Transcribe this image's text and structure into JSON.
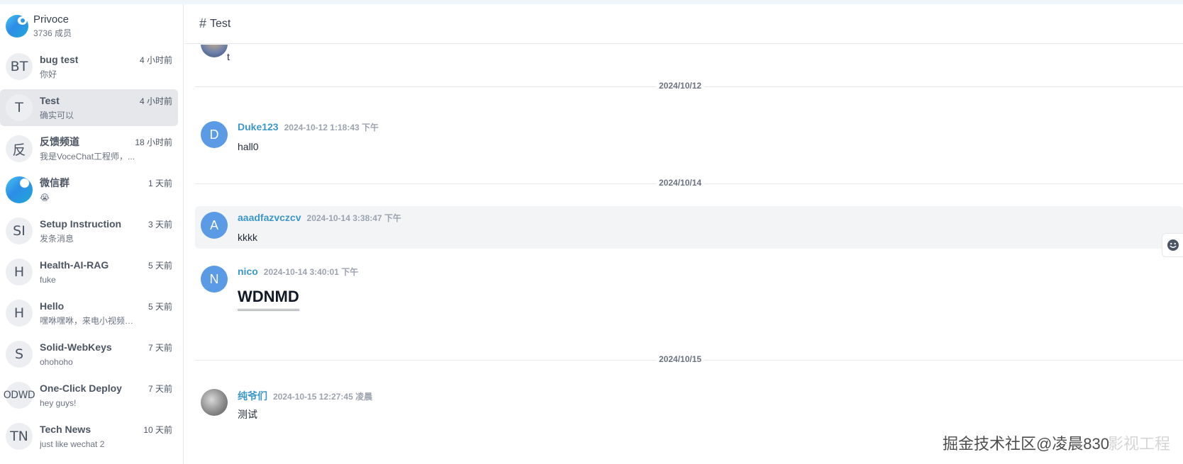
{
  "server": {
    "name": "Privoce",
    "members": "3736 成员"
  },
  "channels": [
    {
      "avatar": "BT",
      "name": "bug test",
      "time": "4 小时前",
      "last": "你好",
      "active": false
    },
    {
      "avatar": "T",
      "name": "Test",
      "time": "4 小时前",
      "last": "确实可以",
      "active": true
    },
    {
      "avatar": "反",
      "name": "反馈频道",
      "time": "18 小时前",
      "last": "我是VoceChat工程师，...",
      "active": false
    },
    {
      "avatar": "",
      "name": "微信群",
      "time": "1 天前",
      "last": "😭",
      "active": false
    },
    {
      "avatar": "SI",
      "name": "Setup Instruction",
      "time": "3 天前",
      "last": "发条消息",
      "active": false
    },
    {
      "avatar": "H",
      "name": "Health-AI-RAG",
      "time": "5 天前",
      "last": "fuke",
      "active": false
    },
    {
      "avatar": "H",
      "name": "Hello",
      "time": "5 天前",
      "last": "嘿咻嘿咻，来电小视频啊...",
      "active": false
    },
    {
      "avatar": "S",
      "name": "Solid-WebKeys",
      "time": "7 天前",
      "last": "ohohoho",
      "active": false
    },
    {
      "avatar": "ODWD",
      "name": "One-Click Deploy",
      "time": "7 天前",
      "last": "hey guys!",
      "active": false
    },
    {
      "avatar": "TN",
      "name": "Tech News",
      "time": "10 天前",
      "last": "just like wechat 2",
      "active": false
    }
  ],
  "header": {
    "hash": "#",
    "title": "Test"
  },
  "feed": {
    "top_partial_text": "t",
    "dividers": [
      "2024/10/12",
      "2024/10/14",
      "2024/10/15"
    ],
    "messages": [
      {
        "avatar": "D",
        "author": "Duke123",
        "time": "2024-10-12 1:18:43 下午",
        "text": "hall0"
      },
      {
        "avatar": "A",
        "author": "aaadfazvczcv",
        "time": "2024-10-14 3:38:47 下午",
        "text": "kkkk"
      },
      {
        "avatar": "N",
        "author": "nico",
        "time": "2024-10-14 3:40:01 下午",
        "text": "WDNMD"
      },
      {
        "avatar": "",
        "author": "纯爷们",
        "time": "2024-10-15 12:27:45 凌晨",
        "text": "测试"
      }
    ]
  },
  "watermark": {
    "main": "掘金技术社区@凌晨830",
    "ghost": "影视工程"
  },
  "colors": {
    "accent": "#3b97c7",
    "avatar_blue": "#5b9ae4",
    "active_bg": "#e5e7eb"
  },
  "icons": {
    "emoji": "smiley-icon",
    "hash": "hash-icon"
  }
}
